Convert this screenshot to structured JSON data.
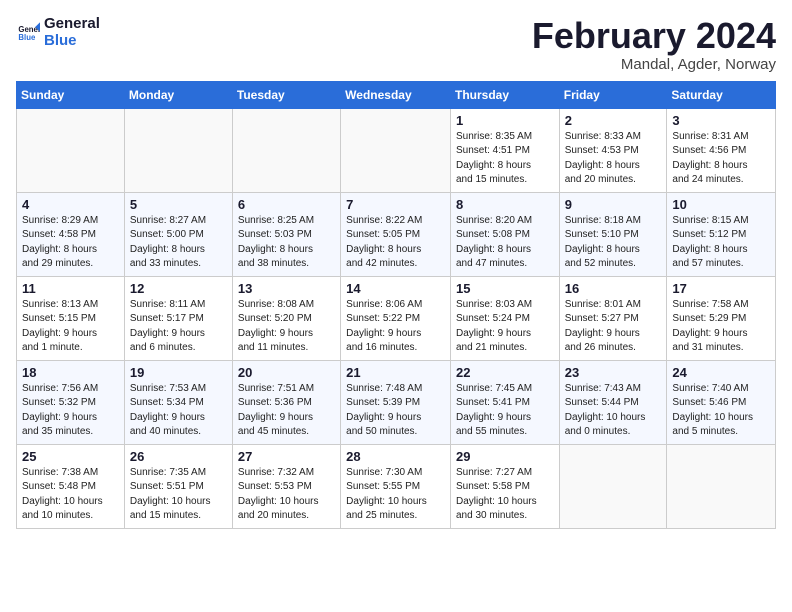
{
  "header": {
    "logo_line1": "General",
    "logo_line2": "Blue",
    "title": "February 2024",
    "subtitle": "Mandal, Agder, Norway"
  },
  "weekdays": [
    "Sunday",
    "Monday",
    "Tuesday",
    "Wednesday",
    "Thursday",
    "Friday",
    "Saturday"
  ],
  "weeks": [
    [
      {
        "num": "",
        "info": ""
      },
      {
        "num": "",
        "info": ""
      },
      {
        "num": "",
        "info": ""
      },
      {
        "num": "",
        "info": ""
      },
      {
        "num": "1",
        "info": "Sunrise: 8:35 AM\nSunset: 4:51 PM\nDaylight: 8 hours\nand 15 minutes."
      },
      {
        "num": "2",
        "info": "Sunrise: 8:33 AM\nSunset: 4:53 PM\nDaylight: 8 hours\nand 20 minutes."
      },
      {
        "num": "3",
        "info": "Sunrise: 8:31 AM\nSunset: 4:56 PM\nDaylight: 8 hours\nand 24 minutes."
      }
    ],
    [
      {
        "num": "4",
        "info": "Sunrise: 8:29 AM\nSunset: 4:58 PM\nDaylight: 8 hours\nand 29 minutes."
      },
      {
        "num": "5",
        "info": "Sunrise: 8:27 AM\nSunset: 5:00 PM\nDaylight: 8 hours\nand 33 minutes."
      },
      {
        "num": "6",
        "info": "Sunrise: 8:25 AM\nSunset: 5:03 PM\nDaylight: 8 hours\nand 38 minutes."
      },
      {
        "num": "7",
        "info": "Sunrise: 8:22 AM\nSunset: 5:05 PM\nDaylight: 8 hours\nand 42 minutes."
      },
      {
        "num": "8",
        "info": "Sunrise: 8:20 AM\nSunset: 5:08 PM\nDaylight: 8 hours\nand 47 minutes."
      },
      {
        "num": "9",
        "info": "Sunrise: 8:18 AM\nSunset: 5:10 PM\nDaylight: 8 hours\nand 52 minutes."
      },
      {
        "num": "10",
        "info": "Sunrise: 8:15 AM\nSunset: 5:12 PM\nDaylight: 8 hours\nand 57 minutes."
      }
    ],
    [
      {
        "num": "11",
        "info": "Sunrise: 8:13 AM\nSunset: 5:15 PM\nDaylight: 9 hours\nand 1 minute."
      },
      {
        "num": "12",
        "info": "Sunrise: 8:11 AM\nSunset: 5:17 PM\nDaylight: 9 hours\nand 6 minutes."
      },
      {
        "num": "13",
        "info": "Sunrise: 8:08 AM\nSunset: 5:20 PM\nDaylight: 9 hours\nand 11 minutes."
      },
      {
        "num": "14",
        "info": "Sunrise: 8:06 AM\nSunset: 5:22 PM\nDaylight: 9 hours\nand 16 minutes."
      },
      {
        "num": "15",
        "info": "Sunrise: 8:03 AM\nSunset: 5:24 PM\nDaylight: 9 hours\nand 21 minutes."
      },
      {
        "num": "16",
        "info": "Sunrise: 8:01 AM\nSunset: 5:27 PM\nDaylight: 9 hours\nand 26 minutes."
      },
      {
        "num": "17",
        "info": "Sunrise: 7:58 AM\nSunset: 5:29 PM\nDaylight: 9 hours\nand 31 minutes."
      }
    ],
    [
      {
        "num": "18",
        "info": "Sunrise: 7:56 AM\nSunset: 5:32 PM\nDaylight: 9 hours\nand 35 minutes."
      },
      {
        "num": "19",
        "info": "Sunrise: 7:53 AM\nSunset: 5:34 PM\nDaylight: 9 hours\nand 40 minutes."
      },
      {
        "num": "20",
        "info": "Sunrise: 7:51 AM\nSunset: 5:36 PM\nDaylight: 9 hours\nand 45 minutes."
      },
      {
        "num": "21",
        "info": "Sunrise: 7:48 AM\nSunset: 5:39 PM\nDaylight: 9 hours\nand 50 minutes."
      },
      {
        "num": "22",
        "info": "Sunrise: 7:45 AM\nSunset: 5:41 PM\nDaylight: 9 hours\nand 55 minutes."
      },
      {
        "num": "23",
        "info": "Sunrise: 7:43 AM\nSunset: 5:44 PM\nDaylight: 10 hours\nand 0 minutes."
      },
      {
        "num": "24",
        "info": "Sunrise: 7:40 AM\nSunset: 5:46 PM\nDaylight: 10 hours\nand 5 minutes."
      }
    ],
    [
      {
        "num": "25",
        "info": "Sunrise: 7:38 AM\nSunset: 5:48 PM\nDaylight: 10 hours\nand 10 minutes."
      },
      {
        "num": "26",
        "info": "Sunrise: 7:35 AM\nSunset: 5:51 PM\nDaylight: 10 hours\nand 15 minutes."
      },
      {
        "num": "27",
        "info": "Sunrise: 7:32 AM\nSunset: 5:53 PM\nDaylight: 10 hours\nand 20 minutes."
      },
      {
        "num": "28",
        "info": "Sunrise: 7:30 AM\nSunset: 5:55 PM\nDaylight: 10 hours\nand 25 minutes."
      },
      {
        "num": "29",
        "info": "Sunrise: 7:27 AM\nSunset: 5:58 PM\nDaylight: 10 hours\nand 30 minutes."
      },
      {
        "num": "",
        "info": ""
      },
      {
        "num": "",
        "info": ""
      }
    ]
  ]
}
